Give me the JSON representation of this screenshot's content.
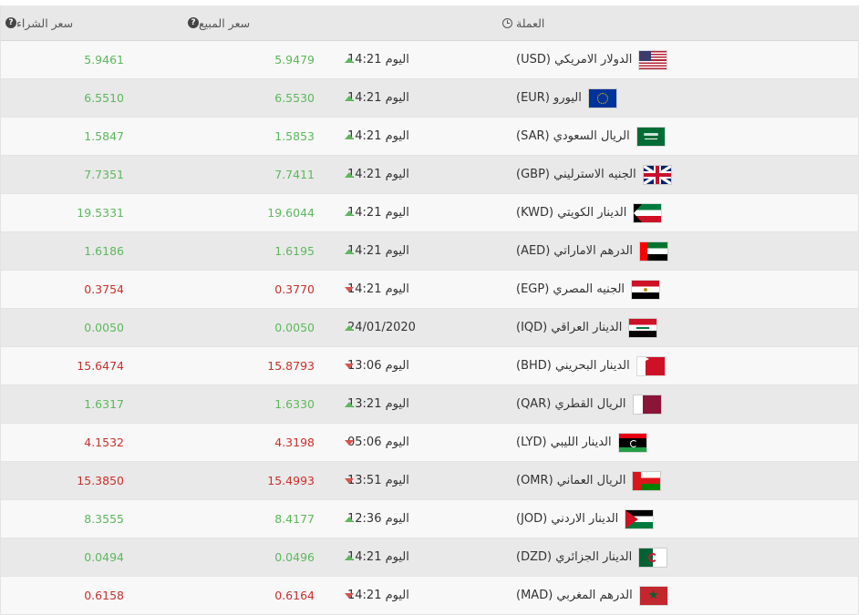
{
  "header": {
    "currency": "العملة",
    "sell": "سعر المبيع",
    "buy": "سعر الشراء",
    "time_icon": "clock-icon",
    "help_icon": "help-icon"
  },
  "colors": {
    "up": "#5cb85c",
    "down": "#c9302c"
  },
  "rows": [
    {
      "flag": "flag-usa-icon",
      "code": "usd",
      "name": "الدولار الامريكي (USD)",
      "time": "اليوم 14:21",
      "dir": "up",
      "sell": "5.9479",
      "buy": "5.9461"
    },
    {
      "flag": "flag-eu-icon",
      "code": "eur",
      "name": "اليورو (EUR)",
      "time": "اليوم 14:21",
      "dir": "up",
      "sell": "6.5530",
      "buy": "6.5510"
    },
    {
      "flag": "flag-saudi-icon",
      "code": "sar",
      "name": "الريال السعودي (SAR)",
      "time": "اليوم 14:21",
      "dir": "up",
      "sell": "1.5853",
      "buy": "1.5847"
    },
    {
      "flag": "flag-uk-icon",
      "code": "gbp",
      "name": "الجنيه الاسترليني (GBP)",
      "time": "اليوم 14:21",
      "dir": "up",
      "sell": "7.7411",
      "buy": "7.7351"
    },
    {
      "flag": "flag-kuwait-icon",
      "code": "kwd",
      "name": "الدينار الكويتي (KWD)",
      "time": "اليوم 14:21",
      "dir": "up",
      "sell": "19.6044",
      "buy": "19.5331"
    },
    {
      "flag": "flag-uae-icon",
      "code": "aed",
      "name": "الدرهم الاماراتي (AED)",
      "time": "اليوم 14:21",
      "dir": "up",
      "sell": "1.6195",
      "buy": "1.6186"
    },
    {
      "flag": "flag-egypt-icon",
      "code": "egp",
      "name": "الجنيه المصري (EGP)",
      "time": "اليوم 14:21",
      "dir": "down",
      "sell": "0.3770",
      "buy": "0.3754"
    },
    {
      "flag": "flag-iraq-icon",
      "code": "iqd",
      "name": "الدينار العراقي (IQD)",
      "time": "24/01/2020",
      "dir": "up",
      "sell": "0.0050",
      "buy": "0.0050"
    },
    {
      "flag": "flag-bahrain-icon",
      "code": "bhd",
      "name": "الدينار البحريني (BHD)",
      "time": "اليوم 13:06",
      "dir": "down",
      "sell": "15.8793",
      "buy": "15.6474"
    },
    {
      "flag": "flag-qatar-icon",
      "code": "qar",
      "name": "الريال القطري (QAR)",
      "time": "اليوم 13:21",
      "dir": "up",
      "sell": "1.6330",
      "buy": "1.6317"
    },
    {
      "flag": "flag-libya-icon",
      "code": "lyd",
      "name": "الدينار الليبي (LYD)",
      "time": "اليوم 05:06",
      "dir": "down",
      "sell": "4.3198",
      "buy": "4.1532"
    },
    {
      "flag": "flag-oman-icon",
      "code": "omr",
      "name": "الريال العماني (OMR)",
      "time": "اليوم 13:51",
      "dir": "down",
      "sell": "15.4993",
      "buy": "15.3850"
    },
    {
      "flag": "flag-jordan-icon",
      "code": "jod",
      "name": "الدينار الاردني (JOD)",
      "time": "اليوم 12:36",
      "dir": "up",
      "sell": "8.4177",
      "buy": "8.3555"
    },
    {
      "flag": "flag-algeria-icon",
      "code": "dzd",
      "name": "الدينار الجزائري (DZD)",
      "time": "اليوم 14:21",
      "dir": "up",
      "sell": "0.0496",
      "buy": "0.0494"
    },
    {
      "flag": "flag-morocco-icon",
      "code": "mad",
      "name": "الدرهم المغربي (MAD)",
      "time": "اليوم 14:21",
      "dir": "down",
      "sell": "0.6164",
      "buy": "0.6158"
    }
  ]
}
